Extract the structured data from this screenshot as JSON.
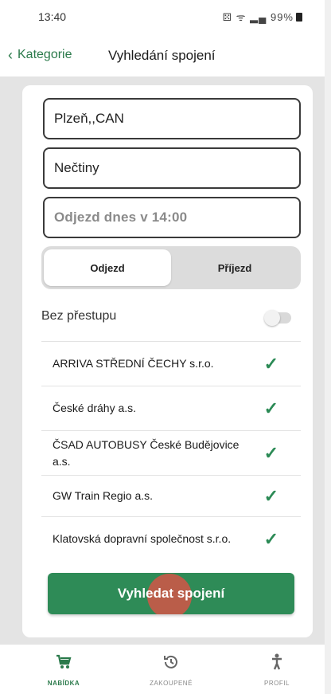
{
  "status": {
    "time": "13:40",
    "icons_text": "⚄ ᯤ ▂▄ 99%"
  },
  "header": {
    "back_label": "Kategorie",
    "title": "Vyhledání spojení"
  },
  "form": {
    "from_value": "Plzeň,,CAN",
    "to_value": "Nečtiny",
    "departure_text": "Odjezd dnes v 14:00",
    "segment": {
      "options": [
        "Odjezd",
        "Příjezd"
      ],
      "selected": "Odjezd"
    },
    "no_transfer_label": "Bez přestupu",
    "no_transfer_enabled": false,
    "carriers": [
      {
        "name": "ARRIVA STŘEDNÍ ČECHY s.r.o.",
        "checked": true
      },
      {
        "name": "České dráhy a.s.",
        "checked": true
      },
      {
        "name": "ČSAD AUTOBUSY České Budějovice a.s.",
        "checked": true
      },
      {
        "name": "GW Train Regio a.s.",
        "checked": true
      },
      {
        "name": "Klatovská dopravní společnost s.r.o.",
        "checked": true
      }
    ],
    "search_button": "Vyhledat spojení"
  },
  "bottom_nav": [
    {
      "label": "NABÍDKA",
      "icon": "cart-icon",
      "active": true
    },
    {
      "label": "ZAKOUPENÉ",
      "icon": "history-icon",
      "active": false
    },
    {
      "label": "PROFIL",
      "icon": "person-icon",
      "active": false
    }
  ],
  "colors": {
    "accent": "#2e8b57",
    "background": "#e4e4e4"
  }
}
